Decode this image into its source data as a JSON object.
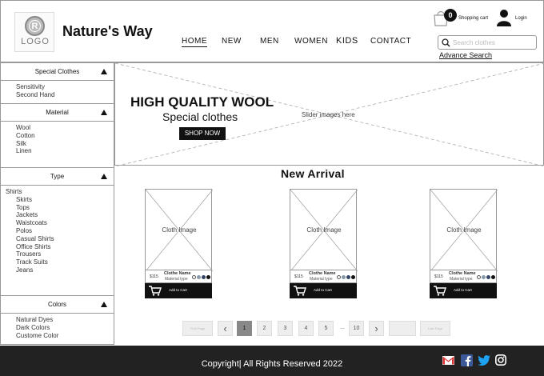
{
  "header": {
    "logo_text": "LOGO",
    "logo_mark": "R",
    "brand": "Nature's Way",
    "nav": [
      {
        "label": "HOME",
        "active": true
      },
      {
        "label": "NEW"
      },
      {
        "label": "MEN"
      },
      {
        "label": "WOMEN"
      },
      {
        "label": "KIDS"
      },
      {
        "label": "CONTACT"
      }
    ],
    "cart_count": "0",
    "cart_label": "Shopping cart",
    "login_label": "Login",
    "search_placeholder": "Search clothes",
    "advance_search": "Advance Search"
  },
  "sidebar": {
    "special": {
      "title": "Special Clothes",
      "items": [
        "Sensitivity",
        "Second Hand"
      ]
    },
    "material": {
      "title": "Material",
      "items": [
        "Wool",
        "Cotton",
        "Silk",
        "Linen"
      ]
    },
    "type": {
      "title": "Type",
      "root": "Shirts",
      "items": [
        "Skirts",
        "Tops",
        "Jackets",
        "Waistcoats",
        "Polos",
        "Casual Shirts",
        "Office Shirts",
        "Trousers",
        "Track Suits",
        "Jeans"
      ]
    },
    "colors": {
      "title": "Colors",
      "items": [
        "Natural Dyes",
        "Dark Colors",
        "Custome Color"
      ]
    }
  },
  "hero": {
    "title": "HIGH QUALITY WOOL",
    "subtitle": "Special clothes",
    "button": "SHOP NOW",
    "placeholder": "Slider images here"
  },
  "new_arrival": {
    "title": "New Arrival",
    "products": [
      {
        "image_label": "Cloth Image",
        "price": "$115",
        "name": "Clothe Name",
        "material": "Material type",
        "add": "Add to Cart"
      },
      {
        "image_label": "Cloth Image",
        "price": "$115",
        "name": "Clothe Name",
        "material": "Material type",
        "add": "Add to Cart"
      },
      {
        "image_label": "Cloth Image",
        "price": "$115",
        "name": "Clothe Name",
        "material": "Material type",
        "add": "Add to Cart"
      }
    ],
    "swatch_colors": [
      "#ffffff",
      "#8899aa",
      "#334466",
      "#111111"
    ]
  },
  "pagination": {
    "first": "First Page",
    "prev": "‹",
    "pages": [
      "1",
      "2",
      "3",
      "4",
      "5"
    ],
    "ellipsis": "...",
    "last_num": "10",
    "next": "›",
    "last": "Last Page",
    "current": "1"
  },
  "footer": {
    "copyright": "Copyright| All Rights Reserved 2022",
    "social": [
      "gmail-icon",
      "facebook-icon",
      "twitter-icon",
      "instagram-icon"
    ]
  }
}
